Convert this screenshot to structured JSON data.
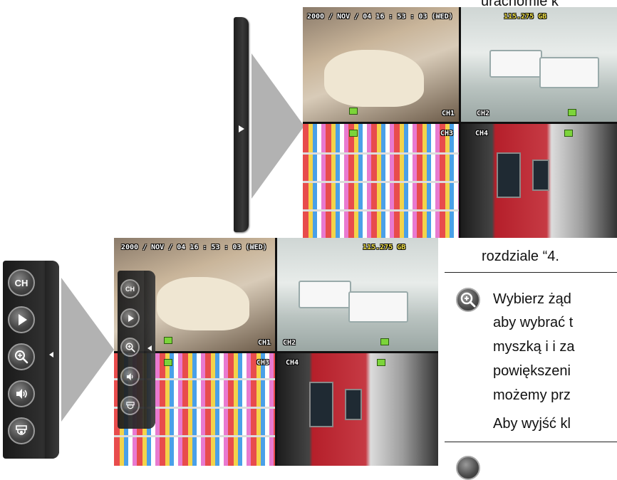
{
  "doc": {
    "top_fragment": "urachomie k",
    "lines": [
      "rozdziale “4.",
      "Wybierz żąd",
      "aby wybrać t",
      "myszką i i za",
      "powiększeni",
      "możemy prz",
      "Aby wyjść kl"
    ]
  },
  "osd": {
    "datetime": "2000 / NOV / 04  16 : 53 : 03 (WED)",
    "storage": "115.275 GB",
    "channels": [
      "CH1",
      "CH2",
      "CH3",
      "CH4"
    ]
  },
  "toolbar": {
    "ch_label": "CH",
    "icons": [
      "channel-icon",
      "play-icon",
      "zoom-icon",
      "audio-icon",
      "ptz-icon"
    ]
  },
  "colors": {
    "triangle": "#b2b2b2",
    "toolbar": "#2a2a2a",
    "osd_text": "#ffffff",
    "osd_accent": "#f3e34a",
    "record_indicator": "#7cd43a"
  }
}
